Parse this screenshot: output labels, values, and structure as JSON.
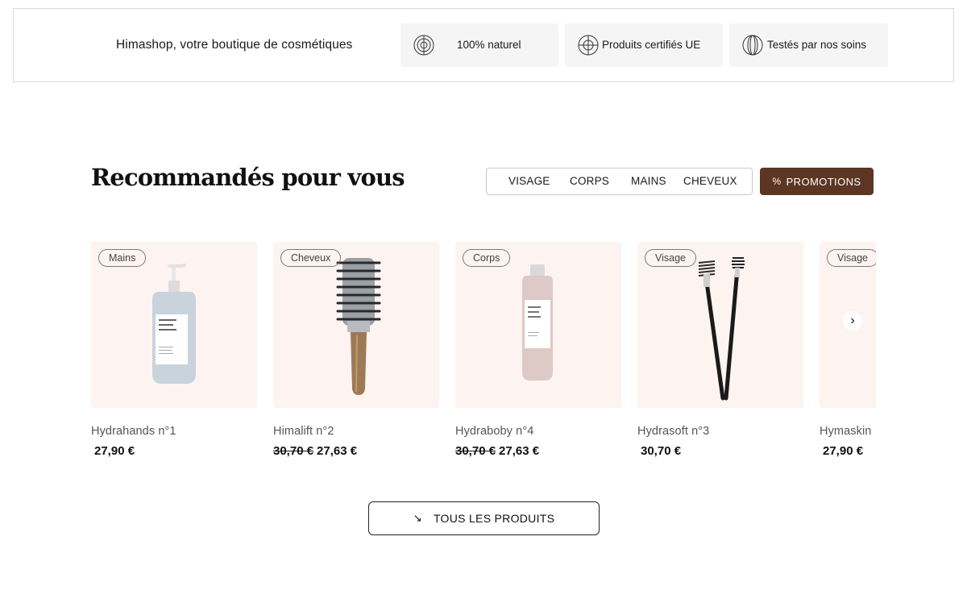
{
  "banner": {
    "title": "Himashop, votre boutique de cosmétiques",
    "features": [
      {
        "label": "100% naturel",
        "icon": "target-rings-icon"
      },
      {
        "label": "Produits certifiés UE",
        "icon": "crosshair-icon"
      },
      {
        "label": "Testés par nos soins",
        "icon": "overlap-rings-icon"
      }
    ]
  },
  "section": {
    "title": "Recommandés pour vous",
    "filters": [
      "VISAGE",
      "CORPS",
      "MAINS",
      "CHEVEUX"
    ],
    "promo_label": "PROMOTIONS",
    "promo_icon": "percent-icon"
  },
  "products": [
    {
      "tag": "Mains",
      "name": "Hydrahands n°1",
      "old_price": "",
      "price": "27,90 €",
      "image": "pump-bottle"
    },
    {
      "tag": "Cheveux",
      "name": "Himalift n°2",
      "old_price": "30,70 €",
      "price": "27,63 €",
      "image": "round-brush"
    },
    {
      "tag": "Corps",
      "name": "Hydraboby n°4",
      "old_price": "30,70 €",
      "price": "27,63 €",
      "image": "tall-bottle"
    },
    {
      "tag": "Visage",
      "name": "Hydrasoft n°3",
      "old_price": "",
      "price": "30,70 €",
      "image": "brow-brushes"
    },
    {
      "tag": "Visage",
      "name": "Hymaskin",
      "old_price": "",
      "price": "27,90 €",
      "image": "partial"
    }
  ],
  "carousel": {
    "next_icon": "chevron-right-icon"
  },
  "all_products": {
    "label": "TOUS LES PRODUITS",
    "icon": "arrow-down-right-icon"
  },
  "colors": {
    "accent": "#5b3622",
    "card_bg": "#fdf3f0",
    "feature_bg": "#f5f5f5"
  }
}
